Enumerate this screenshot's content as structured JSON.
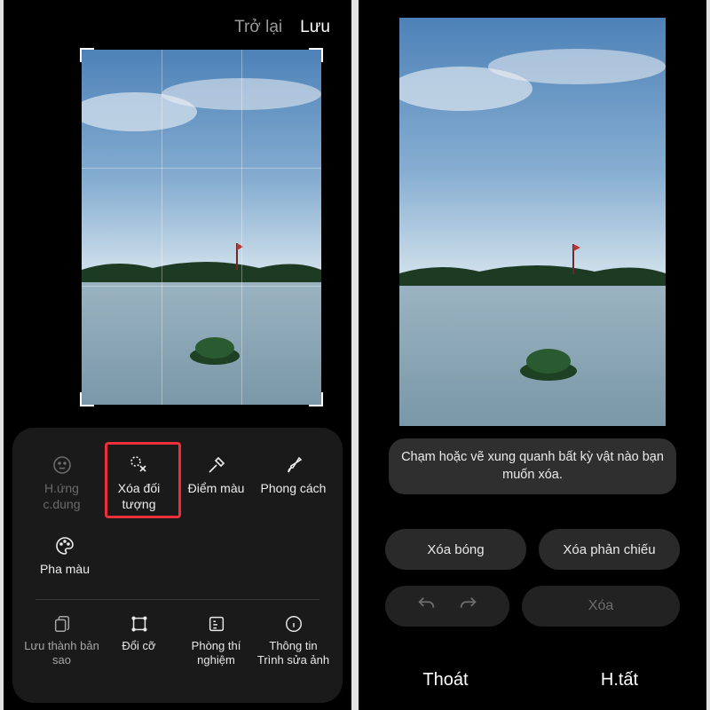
{
  "left": {
    "topActions": {
      "back": "Trở lại",
      "save": "Lưu"
    },
    "tools": {
      "portrait": "H.ứng c.dung",
      "objectEraser": "Xóa đối tượng",
      "spotColor": "Điểm màu",
      "style": "Phong cách",
      "colorMix": "Pha màu"
    },
    "bottomTools": {
      "saveCopy": "Lưu thành bản sao",
      "resize": "Đổi cỡ",
      "labs": "Phòng thí nghiệm",
      "about": "Thông tin Trình sửa ảnh"
    }
  },
  "right": {
    "hint": "Chạm hoặc vẽ xung quanh bất kỳ vật nào bạn muốn xóa.",
    "removeShadow": "Xóa bóng",
    "removeReflection": "Xóa phản chiếu",
    "erase": "Xóa",
    "exit": "Thoát",
    "done": "H.tất"
  }
}
